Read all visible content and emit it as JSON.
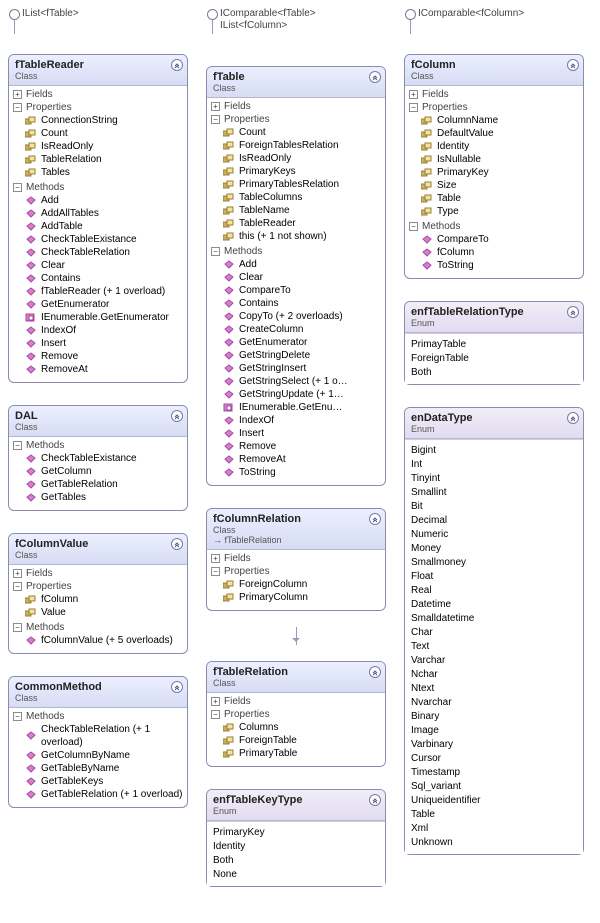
{
  "icons": {
    "plus": "+",
    "minus": "−"
  },
  "section_labels": {
    "fields": "Fields",
    "properties": "Properties",
    "methods": "Methods"
  },
  "col1": {
    "lollipop0": "IList<fTable>",
    "boxes": [
      {
        "name": "fTableReader",
        "kind": "Class",
        "sections": [
          {
            "label": "fields",
            "open": false
          },
          {
            "label": "properties",
            "open": true,
            "items": [
              {
                "t": "prop",
                "txt": "ConnectionString"
              },
              {
                "t": "prop",
                "txt": "Count"
              },
              {
                "t": "prop",
                "txt": "IsReadOnly"
              },
              {
                "t": "prop",
                "txt": "TableRelation"
              },
              {
                "t": "prop",
                "txt": "Tables"
              }
            ]
          },
          {
            "label": "methods",
            "open": true,
            "items": [
              {
                "t": "method",
                "txt": "Add"
              },
              {
                "t": "method",
                "txt": "AddAllTables"
              },
              {
                "t": "method",
                "txt": "AddTable"
              },
              {
                "t": "method",
                "txt": "CheckTableExistance"
              },
              {
                "t": "method",
                "txt": "CheckTableRelation"
              },
              {
                "t": "method",
                "txt": "Clear"
              },
              {
                "t": "method",
                "txt": "Contains"
              },
              {
                "t": "method",
                "txt": "fTableReader (+ 1 overload)"
              },
              {
                "t": "method",
                "txt": "GetEnumerator"
              },
              {
                "t": "explicit",
                "txt": "IEnumerable.GetEnumerator"
              },
              {
                "t": "method",
                "txt": "IndexOf"
              },
              {
                "t": "method",
                "txt": "Insert"
              },
              {
                "t": "method",
                "txt": "Remove"
              },
              {
                "t": "method",
                "txt": "RemoveAt"
              }
            ]
          }
        ]
      },
      {
        "name": "DAL",
        "kind": "Class",
        "sections": [
          {
            "label": "methods",
            "open": true,
            "items": [
              {
                "t": "method",
                "txt": "CheckTableExistance"
              },
              {
                "t": "method",
                "txt": "GetColumn"
              },
              {
                "t": "method",
                "txt": "GetTableRelation"
              },
              {
                "t": "method",
                "txt": "GetTables"
              }
            ]
          }
        ]
      },
      {
        "name": "fColumnValue",
        "kind": "Class",
        "sections": [
          {
            "label": "fields",
            "open": false
          },
          {
            "label": "properties",
            "open": true,
            "items": [
              {
                "t": "prop",
                "txt": "fColumn"
              },
              {
                "t": "prop",
                "txt": "Value"
              }
            ]
          },
          {
            "label": "methods",
            "open": true,
            "items": [
              {
                "t": "method",
                "txt": "fColumnValue (+ 5 overloads)"
              }
            ]
          }
        ]
      },
      {
        "name": "CommonMethod",
        "kind": "Class",
        "sections": [
          {
            "label": "methods",
            "open": true,
            "items": [
              {
                "t": "method",
                "txt": "CheckTableRelation (+ 1 overload)"
              },
              {
                "t": "method",
                "txt": "GetColumnByName"
              },
              {
                "t": "method",
                "txt": "GetTableByName"
              },
              {
                "t": "method",
                "txt": "GetTableKeys"
              },
              {
                "t": "method",
                "txt": "GetTableRelation (+ 1 overload)"
              }
            ]
          }
        ]
      }
    ]
  },
  "col2": {
    "lollipop0": "IComparable<fTable>\nIList<fColumn>",
    "boxes": [
      {
        "name": "fTable",
        "kind": "Class",
        "sections": [
          {
            "label": "fields",
            "open": false
          },
          {
            "label": "properties",
            "open": true,
            "items": [
              {
                "t": "prop",
                "txt": "Count"
              },
              {
                "t": "prop",
                "txt": "ForeignTablesRelation"
              },
              {
                "t": "prop",
                "txt": "IsReadOnly"
              },
              {
                "t": "prop",
                "txt": "PrimaryKeys"
              },
              {
                "t": "prop",
                "txt": "PrimaryTablesRelation"
              },
              {
                "t": "prop",
                "txt": "TableColumns"
              },
              {
                "t": "prop",
                "txt": "TableName"
              },
              {
                "t": "prop",
                "txt": "TableReader"
              },
              {
                "t": "prop",
                "txt": "this (+ 1 not shown)"
              }
            ]
          },
          {
            "label": "methods",
            "open": true,
            "items": [
              {
                "t": "method",
                "txt": "Add"
              },
              {
                "t": "method",
                "txt": "Clear"
              },
              {
                "t": "method",
                "txt": "CompareTo"
              },
              {
                "t": "method",
                "txt": "Contains"
              },
              {
                "t": "method",
                "txt": "CopyTo (+ 2 overloads)"
              },
              {
                "t": "method",
                "txt": "CreateColumn"
              },
              {
                "t": "method",
                "txt": "GetEnumerator"
              },
              {
                "t": "method",
                "txt": "GetStringDelete"
              },
              {
                "t": "method",
                "txt": "GetStringInsert"
              },
              {
                "t": "method",
                "txt": "GetStringSelect (+ 1 o…"
              },
              {
                "t": "method",
                "txt": "GetStringUpdate (+ 1…"
              },
              {
                "t": "explicit",
                "txt": "IEnumerable.GetEnu…"
              },
              {
                "t": "method",
                "txt": "IndexOf"
              },
              {
                "t": "method",
                "txt": "Insert"
              },
              {
                "t": "method",
                "txt": "Remove"
              },
              {
                "t": "method",
                "txt": "RemoveAt"
              },
              {
                "t": "method",
                "txt": "ToString"
              }
            ]
          }
        ]
      },
      {
        "name": "fColumnRelation",
        "kind": "Class",
        "base": "→ fTableRelation",
        "sections": [
          {
            "label": "fields",
            "open": false
          },
          {
            "label": "properties",
            "open": true,
            "items": [
              {
                "t": "prop",
                "txt": "ForeignColumn"
              },
              {
                "t": "prop",
                "txt": "PrimaryColumn"
              }
            ]
          }
        ]
      },
      {
        "name": "fTableRelation",
        "kind": "Class",
        "sections": [
          {
            "label": "fields",
            "open": false
          },
          {
            "label": "properties",
            "open": true,
            "items": [
              {
                "t": "prop",
                "txt": "Columns"
              },
              {
                "t": "prop",
                "txt": "ForeignTable"
              },
              {
                "t": "prop",
                "txt": "PrimaryTable"
              }
            ]
          }
        ]
      },
      {
        "name": "enfTableKeyType",
        "kind": "Enum",
        "enum": true,
        "items": [
          "PrimaryKey",
          "Identity",
          "Both",
          "None"
        ]
      }
    ]
  },
  "col3": {
    "lollipop0": "IComparable<fColumn>",
    "boxes": [
      {
        "name": "fColumn",
        "kind": "Class",
        "sections": [
          {
            "label": "fields",
            "open": false
          },
          {
            "label": "properties",
            "open": true,
            "items": [
              {
                "t": "prop",
                "txt": "ColumnName"
              },
              {
                "t": "prop",
                "txt": "DefaultValue"
              },
              {
                "t": "prop",
                "txt": "Identity"
              },
              {
                "t": "prop",
                "txt": "IsNullable"
              },
              {
                "t": "prop",
                "txt": "PrimaryKey"
              },
              {
                "t": "prop",
                "txt": "Size"
              },
              {
                "t": "prop",
                "txt": "Table"
              },
              {
                "t": "prop",
                "txt": "Type"
              }
            ]
          },
          {
            "label": "methods",
            "open": true,
            "items": [
              {
                "t": "method",
                "txt": "CompareTo"
              },
              {
                "t": "method",
                "txt": "fColumn"
              },
              {
                "t": "method",
                "txt": "ToString"
              }
            ]
          }
        ]
      },
      {
        "name": "enfTableRelationType",
        "kind": "Enum",
        "enum": true,
        "items": [
          "PrimayTable",
          "ForeignTable",
          "Both"
        ]
      },
      {
        "name": "enDataType",
        "kind": "Enum",
        "enum": true,
        "items": [
          "Bigint",
          "Int",
          "Tinyint",
          "Smallint",
          "Bit",
          "Decimal",
          "Numeric",
          "Money",
          "Smallmoney",
          "Float",
          "Real",
          "Datetime",
          "Smalldatetime",
          "Char",
          "Text",
          "Varchar",
          "Nchar",
          "Ntext",
          "Nvarchar",
          "Binary",
          "Image",
          "Varbinary",
          "Cursor",
          "Timestamp",
          "Sql_variant",
          "Uniqueidentifier",
          "Table",
          "Xml",
          "Unknown"
        ]
      }
    ]
  },
  "colors": {
    "accent": "#8b8bb0"
  }
}
